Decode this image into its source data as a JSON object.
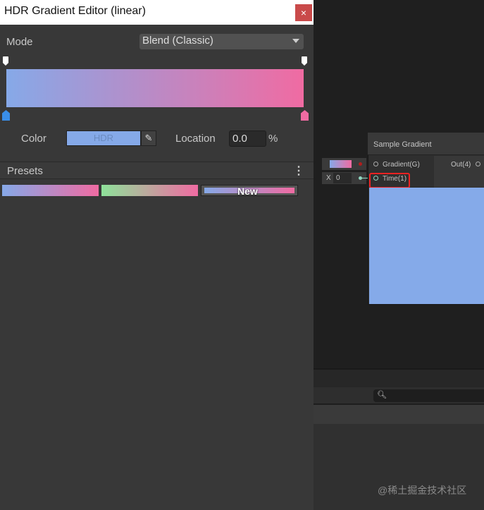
{
  "window": {
    "title": "HDR Gradient Editor (linear)",
    "close_icon": "×"
  },
  "mode": {
    "label": "Mode",
    "value": "Blend (Classic)"
  },
  "gradient": {
    "start_color": "#86a9e8",
    "end_color": "#f06ba2"
  },
  "color": {
    "label": "Color",
    "value_text": "HDR",
    "swatch": "#85a9e8"
  },
  "location": {
    "label": "Location",
    "value": "0.0",
    "unit": "%"
  },
  "presets": {
    "label": "Presets",
    "menu_icon": "⋮",
    "new_label": "New"
  },
  "node": {
    "title": "Sample Gradient",
    "input_gradient": "Gradient(G)",
    "input_time": "Time(1)",
    "output": "Out(4)",
    "x_label": "X",
    "x_value": "0"
  },
  "watermark": "@稀土掘金技术社区"
}
